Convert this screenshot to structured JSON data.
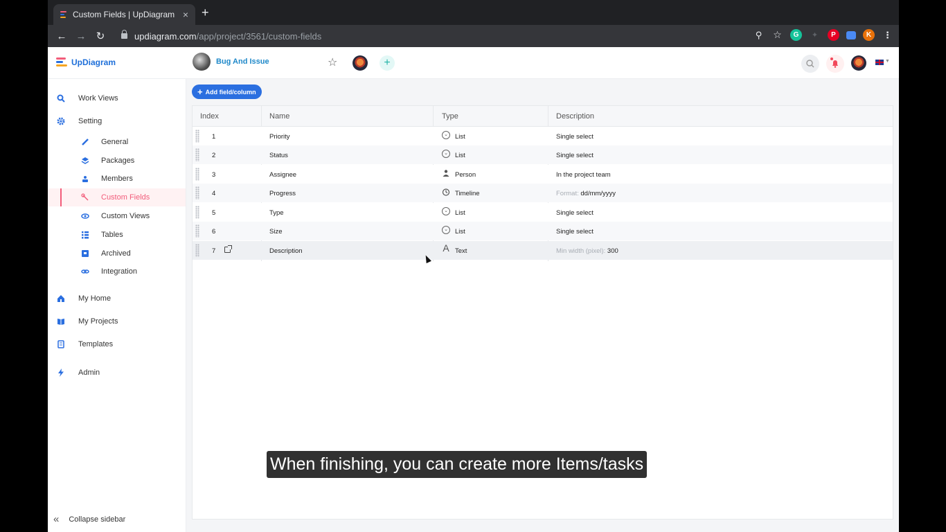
{
  "browser": {
    "tab_title": "Custom Fields | UpDiagram",
    "tab_close": "×",
    "new_tab": "+",
    "url_host": "updiagram.com",
    "url_path": "/app/project/3561/custom-fields",
    "profile_initial": "K"
  },
  "app": {
    "logo_text": "UpDiagram",
    "project_name": "Bug And Issue"
  },
  "sidebar": {
    "items": [
      {
        "label": "Work Views",
        "icon": "search-icon"
      },
      {
        "label": "Setting",
        "icon": "gear-icon"
      },
      {
        "label": "General",
        "icon": "pencil-icon"
      },
      {
        "label": "Packages",
        "icon": "layers-icon"
      },
      {
        "label": "Members",
        "icon": "members-icon"
      },
      {
        "label": "Custom Fields",
        "icon": "wrench-icon"
      },
      {
        "label": "Custom Views",
        "icon": "eye-icon"
      },
      {
        "label": "Tables",
        "icon": "list-icon"
      },
      {
        "label": "Archived",
        "icon": "archive-icon"
      },
      {
        "label": "Integration",
        "icon": "link-icon"
      },
      {
        "label": "My Home",
        "icon": "home-icon"
      },
      {
        "label": "My Projects",
        "icon": "book-icon"
      },
      {
        "label": "Templates",
        "icon": "template-icon"
      },
      {
        "label": "Admin",
        "icon": "bolt-icon"
      }
    ],
    "collapse_label": "Collapse sidebar"
  },
  "content": {
    "add_button": "Add field/column",
    "columns": [
      "Index",
      "Name",
      "Type",
      "Description"
    ],
    "rows": [
      {
        "index": "1",
        "name": "Priority",
        "type": "List",
        "desc": "Single select",
        "desc_prefix": "",
        "type_icon": "list-icon"
      },
      {
        "index": "2",
        "name": "Status",
        "type": "List",
        "desc": "Single select",
        "desc_prefix": "",
        "type_icon": "list-icon"
      },
      {
        "index": "3",
        "name": "Assignee",
        "type": "Person",
        "desc": "In the project team",
        "desc_prefix": "",
        "type_icon": "person-icon"
      },
      {
        "index": "4",
        "name": "Progress",
        "type": "Timeline",
        "desc": "dd/mm/yyyy",
        "desc_prefix": "Format:",
        "type_icon": "timeline-icon"
      },
      {
        "index": "5",
        "name": "Type",
        "type": "List",
        "desc": "Single select",
        "desc_prefix": "",
        "type_icon": "list-icon"
      },
      {
        "index": "6",
        "name": "Size",
        "type": "List",
        "desc": "Single select",
        "desc_prefix": "",
        "type_icon": "list-icon"
      },
      {
        "index": "7",
        "name": "Description",
        "type": "Text",
        "desc": "300",
        "desc_prefix": "Min width (pixel):",
        "type_icon": "text-icon"
      }
    ]
  },
  "caption": "When finishing, you can create more Items/tasks",
  "colors": {
    "accent": "#2b6fe0",
    "active": "#f25c7a",
    "project": "#1e88c9"
  }
}
